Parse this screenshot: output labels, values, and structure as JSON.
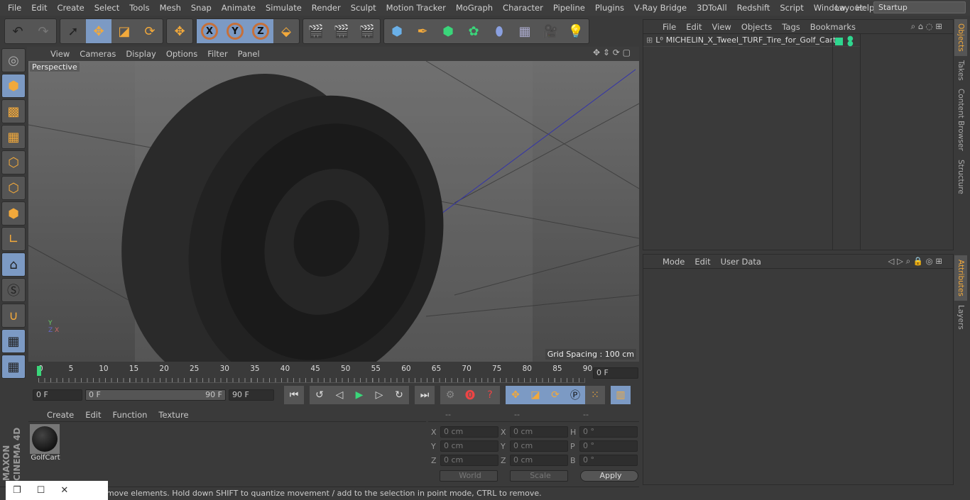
{
  "menu": [
    "File",
    "Edit",
    "Create",
    "Select",
    "Tools",
    "Mesh",
    "Snap",
    "Animate",
    "Simulate",
    "Render",
    "Sculpt",
    "Motion Tracker",
    "MoGraph",
    "Character",
    "Pipeline",
    "Plugins",
    "V-Ray Bridge",
    "3DToAll",
    "Redshift",
    "Script",
    "Window",
    "Help"
  ],
  "layout": {
    "label": "Layout:",
    "value": "Startup"
  },
  "viewport": {
    "menu": [
      "View",
      "Cameras",
      "Display",
      "Options",
      "Filter",
      "Panel"
    ],
    "label": "Perspective",
    "grid_spacing": "Grid Spacing : 100 cm"
  },
  "timeline": {
    "ticks": [
      "0",
      "5",
      "10",
      "15",
      "20",
      "25",
      "30",
      "35",
      "40",
      "45",
      "50",
      "55",
      "60",
      "65",
      "70",
      "75",
      "80",
      "85",
      "90"
    ],
    "current": "0 F",
    "start": "0 F",
    "range_start": "0 F",
    "range_end": "90 F",
    "end": "90 F"
  },
  "material": {
    "menu": [
      "Create",
      "Edit",
      "Function",
      "Texture"
    ],
    "name": "GolfCart"
  },
  "coords": {
    "headers": [
      "--",
      "--",
      "--"
    ],
    "rows": [
      [
        "X",
        "0 cm",
        "X",
        "0 cm",
        "H",
        "0 °"
      ],
      [
        "Y",
        "0 cm",
        "Y",
        "0 cm",
        "P",
        "0 °"
      ],
      [
        "Z",
        "0 cm",
        "Z",
        "0 cm",
        "B",
        "0 °"
      ]
    ],
    "mode": "World",
    "mode2": "Scale",
    "apply": "Apply"
  },
  "status": "move elements. Hold down SHIFT to quantize movement / add to the selection in point mode, CTRL to remove.",
  "objects": {
    "menu": [
      "File",
      "Edit",
      "View",
      "Objects",
      "Tags",
      "Bookmarks"
    ],
    "items": [
      {
        "name": "MICHELIN_X_Tweel_TURF_Tire_for_Golf_Cart"
      }
    ]
  },
  "attributes": {
    "menu": [
      "Mode",
      "Edit",
      "User Data"
    ]
  },
  "right_tabs": [
    "Objects",
    "Takes",
    "Content Browser",
    "Structure",
    "Attributes",
    "Layers"
  ],
  "brand": [
    "MAXON",
    "CINEMA 4D"
  ],
  "colors": {
    "accent": "#f2a93b",
    "active": "#7c9ac4",
    "tag": "#2fd68f"
  }
}
